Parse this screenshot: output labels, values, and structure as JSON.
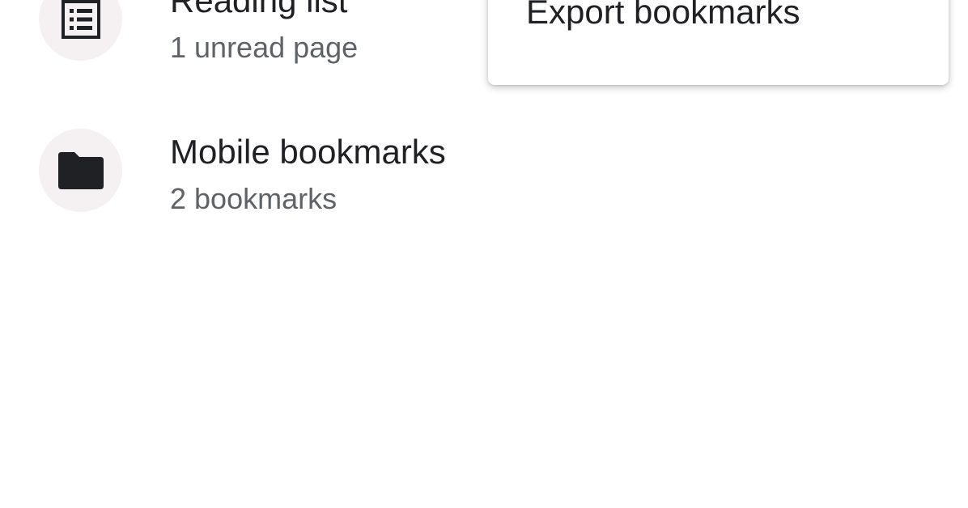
{
  "bookmark_list": {
    "items": [
      {
        "icon": "reading-list-icon",
        "title": "Reading list",
        "subtitle": "1 unread page"
      },
      {
        "icon": "folder-icon",
        "title": "Mobile bookmarks",
        "subtitle": "2 bookmarks"
      }
    ]
  },
  "overflow_menu": {
    "items": [
      {
        "label": "Export bookmarks"
      }
    ]
  },
  "colors": {
    "background": "#ffffff",
    "icon_circle": "#f5f0f1",
    "title_text": "#202124",
    "subtitle_text": "#5f6368"
  }
}
